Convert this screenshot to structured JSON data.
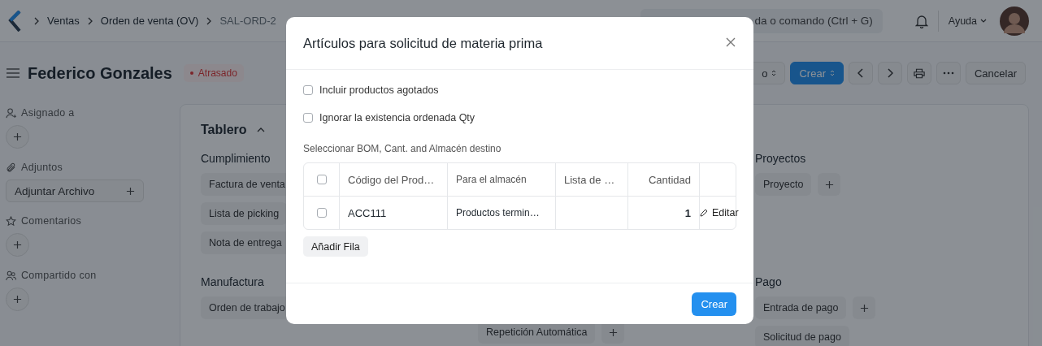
{
  "navbar": {
    "breadcrumbs": [
      "Ventas",
      "Orden de venta (OV)",
      "SAL-ORD-2"
    ],
    "search": {
      "placeholder": "da o comando (Ctrl + G)"
    },
    "help": "Ayuda"
  },
  "header": {
    "title": "Federico Gonzales",
    "status": "Atrasado",
    "actions": [
      {
        "kind": "select",
        "label": "o"
      },
      {
        "kind": "primary",
        "label": "Crear"
      },
      {
        "kind": "prev"
      },
      {
        "kind": "next"
      },
      {
        "kind": "print"
      },
      {
        "kind": "more"
      },
      {
        "kind": "default",
        "label": "Cancelar"
      }
    ]
  },
  "sidebar": [
    {
      "label": "Asignado a",
      "action": {
        "kind": "circle"
      }
    },
    {
      "label": "Adjuntos",
      "action": {
        "kind": "pill",
        "label": "Adjuntar Archivo"
      }
    },
    {
      "label": "Comentarios",
      "action": {
        "kind": "circle"
      }
    },
    {
      "label": "Compartido con",
      "action": {
        "kind": "circle"
      }
    }
  ],
  "dashboard": {
    "title": "Tablero",
    "expanded": true,
    "columns": [
      {
        "groups": [
          {
            "title": "Cumplimiento",
            "items": [
              {
                "label": "Factura de venta",
                "add": false
              },
              {
                "label": "Lista de picking",
                "add": false
              },
              {
                "label": "Nota de entrega",
                "add": false
              }
            ]
          },
          {
            "title": "Manufactura",
            "items": [
              {
                "label": "Orden de trabajo",
                "add": false
              }
            ]
          }
        ]
      },
      {
        "groups": [
          {
            "items": [
              {
                "label": "Repetición Automática",
                "add": true
              }
            ]
          }
        ]
      },
      {
        "groups": [
          {
            "title": "Proyectos",
            "items": [
              {
                "label": "Proyecto",
                "add": true
              }
            ]
          },
          {
            "title": "Pago",
            "items": [
              {
                "label": "Entrada de pago",
                "add": true
              },
              {
                "label": "Solicitud de pago",
                "add": false
              }
            ]
          }
        ]
      }
    ]
  },
  "dialog": {
    "title": "Artículos para solicitud de materia prima",
    "checkboxes": [
      {
        "label": "Incluir productos agotados",
        "checked": false
      },
      {
        "label": "Ignorar la existencia ordenada Qty",
        "checked": false
      }
    ],
    "table": {
      "caption": "Seleccionar BOM, Cant. and Almacén destino",
      "all_selected": false,
      "columns": [
        {
          "label": "Código del Prod…",
          "numeric": false
        },
        {
          "label": "Para el almacén",
          "numeric": false
        },
        {
          "label": "Lista de …",
          "numeric": false
        },
        {
          "label": "Cantidad",
          "numeric": true
        }
      ],
      "rows": [
        {
          "selected": false,
          "code": "ACC111",
          "warehouse": "Productos termin…",
          "qty": "1",
          "action": "Editar"
        }
      ]
    },
    "add_row": "Añadir Fila",
    "primary": "Crear"
  }
}
